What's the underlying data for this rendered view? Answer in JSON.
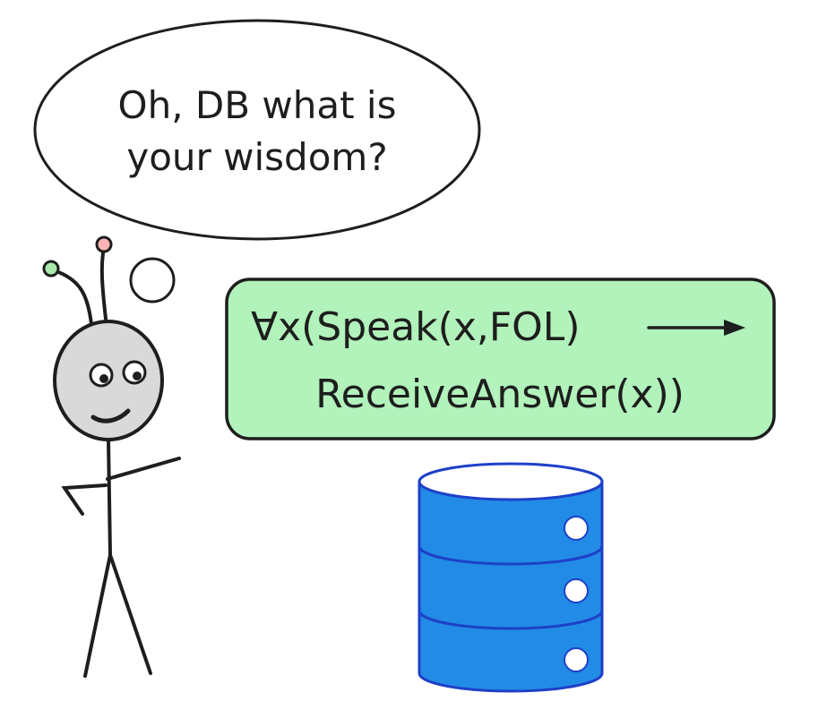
{
  "speech_bubble": {
    "line1": "Oh, DB what is",
    "line2": "your wisdom?"
  },
  "formula_box": {
    "line1": "∀x(Speak(x,FOL)",
    "line2": "ReceiveAnswer(x))",
    "fill_color": "#b2f2bb"
  },
  "database": {
    "icon": "database-icon",
    "fill_color": "#228be6",
    "top_color": "#ffffff"
  },
  "alien": {
    "icon": "alien-stick-figure-icon",
    "head_color": "#d9d9d9",
    "antenna_left_tip_color": "#a9e9a9",
    "antenna_right_tip_color": "#ffb3b3"
  }
}
